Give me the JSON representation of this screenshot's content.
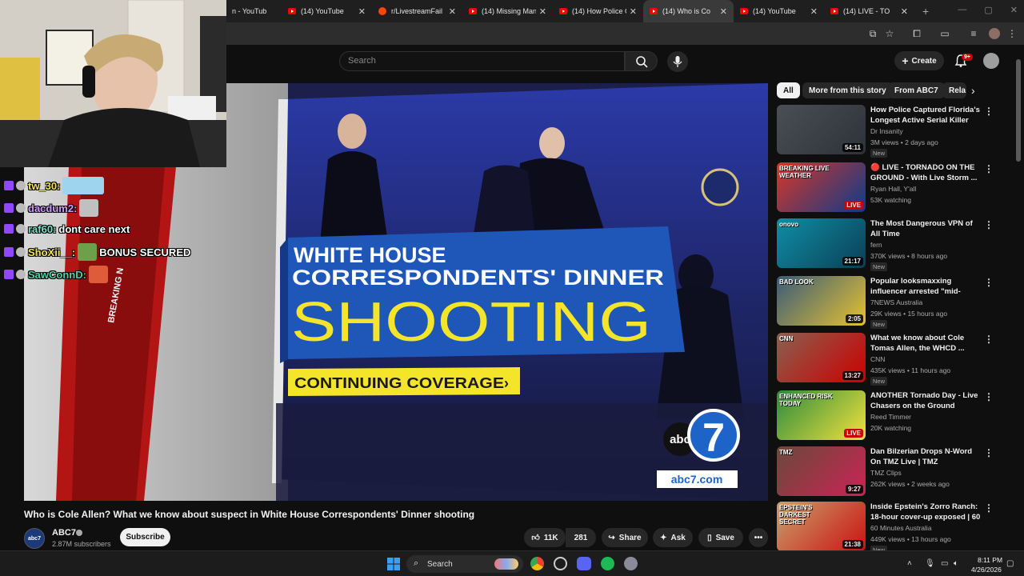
{
  "browser": {
    "tabs": [
      {
        "label": "n - YouTub",
        "icon": "youtube-icon",
        "active": false
      },
      {
        "label": "(14) YouTube",
        "icon": "youtube-icon",
        "active": false
      },
      {
        "label": "r/LivestreamFail",
        "icon": "reddit-icon",
        "active": false
      },
      {
        "label": "(14) Missing Man",
        "icon": "youtube-icon",
        "active": false
      },
      {
        "label": "(14) How Police C",
        "icon": "youtube-icon",
        "active": false
      },
      {
        "label": "(14) Who is Co",
        "icon": "youtube-icon",
        "active": true
      },
      {
        "label": "(14) YouTube",
        "icon": "youtube-icon",
        "active": false
      },
      {
        "label": "(14) LIVE - TO",
        "icon": "youtube-icon",
        "active": false
      }
    ],
    "new_tab": "+"
  },
  "youtube": {
    "search_placeholder": "Search",
    "create_label": "Create",
    "notification_count": "9+",
    "video": {
      "title": "Who is Cole Allen? What we know about suspect in White House Correspondents' Dinner shooting",
      "graphic": {
        "headline_line1": "WHITE HOUSE",
        "headline_line2": "CORRESPONDENTS' DINNER",
        "headline_big": "SHOOTING",
        "coverage": "CONTINUING COVERAGE",
        "network": "abc",
        "channel_number": "7",
        "url": "abc7.com",
        "side_text": "BREAKING N"
      }
    },
    "channel": {
      "name": "ABC7",
      "subscribers": "2.87M subscribers",
      "avatar_text": "abc7",
      "subscribe_label": "Subscribe"
    },
    "actions": {
      "likes": "11K",
      "dislike_count": "281",
      "share": "Share",
      "ask": "Ask",
      "save": "Save"
    },
    "chips": [
      "All",
      "More from this story",
      "From ABC7",
      "Rela"
    ],
    "recommendations": [
      {
        "title": "How Police Captured Florida's Longest Active Serial Killer",
        "channel": "Dr Insanity",
        "meta": "3M views • 2 days ago",
        "badge": "New",
        "duration": "54:11",
        "live": false,
        "thumb_text": ""
      },
      {
        "title": "🔴 LIVE - TORNADO ON THE GROUND - With Live Storm ...",
        "channel": "Ryan Hall, Y'all",
        "meta": "53K watching",
        "badge": "",
        "duration": "LIVE",
        "live": true,
        "thumb_text": "BREAKING LIVE WEATHER"
      },
      {
        "title": "The Most Dangerous VPN of All Time",
        "channel": "fern",
        "meta": "370K views • 8 hours ago",
        "badge": "New",
        "duration": "21:17",
        "live": false,
        "thumb_text": "onovo"
      },
      {
        "title": "Popular looksmaxxing influencer arrested \"mid-strea...",
        "channel": "7NEWS Australia",
        "meta": "29K views • 15 hours ago",
        "badge": "New",
        "duration": "2:05",
        "live": false,
        "thumb_text": "BAD LOOK"
      },
      {
        "title": "What we know about Cole Tomas Allen, the WHCD ...",
        "channel": "CNN",
        "meta": "435K views • 11 hours ago",
        "badge": "New",
        "duration": "13:27",
        "live": false,
        "thumb_text": "CNN"
      },
      {
        "title": "ANOTHER Tornado Day - Live Chasers on the Ground",
        "channel": "Reed Timmer",
        "meta": "20K watching",
        "badge": "",
        "duration": "LIVE",
        "live": true,
        "thumb_text": "ENHANCED RISK TODAY"
      },
      {
        "title": "Dan Bilzerian Drops N-Word On TMZ Live | TMZ",
        "channel": "TMZ Clips",
        "meta": "262K views • 2 weeks ago",
        "badge": "",
        "duration": "9:27",
        "live": false,
        "thumb_text": "TMZ"
      },
      {
        "title": "Inside Epstein's Zorro Ranch: 18-hour cover-up exposed | 60 ...",
        "channel": "60 Minutes Australia",
        "meta": "449K views • 13 hours ago",
        "badge": "New",
        "duration": "21:38",
        "live": false,
        "thumb_text": "EPSTEIN'S DARKEST SECRET"
      }
    ]
  },
  "chat": [
    {
      "user": "tw_30:",
      "message": "",
      "color": "#f2e64a"
    },
    {
      "user": "dacdum2:",
      "message": "",
      "color": "#d39bff"
    },
    {
      "user": "raf60:",
      "message": "dont care next",
      "color": "#7ee0c6"
    },
    {
      "user": "ShoXii__:",
      "message": "BONUS SECURED",
      "color": "#f2e64a"
    },
    {
      "user": "SawConnD:",
      "message": "",
      "color": "#4fd1a5"
    }
  ],
  "taskbar": {
    "search_label": "Search",
    "time": "8:11 PM",
    "date": "4/26/2026"
  },
  "colors": {
    "yt_bg": "#0f0f0f",
    "accent_red": "#ff0000",
    "chyron_blue": "#1f57b8",
    "chyron_yellow": "#f4e42a"
  }
}
